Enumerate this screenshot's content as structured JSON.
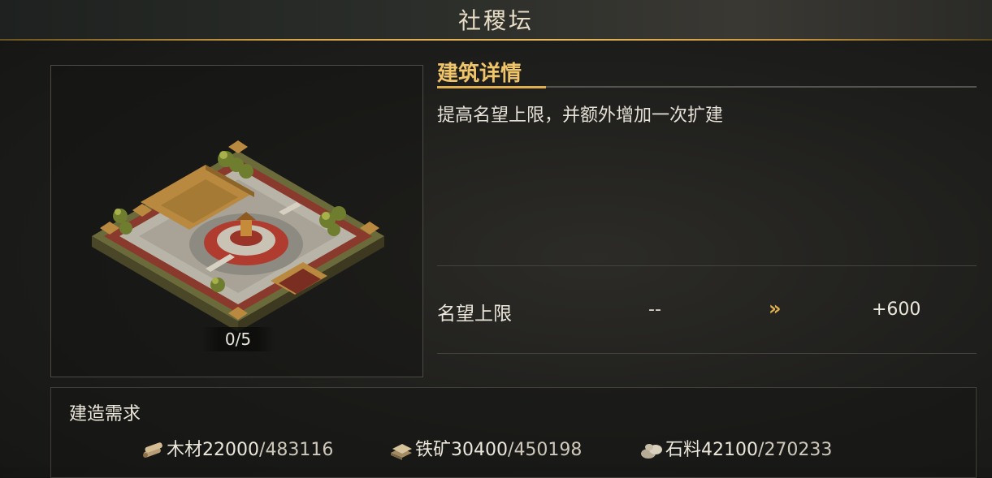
{
  "title": "社稷坛",
  "building_image": {
    "progress": "0/5"
  },
  "details": {
    "heading": "建筑详情",
    "description": "提高名望上限，并额外增加一次扩建"
  },
  "stat": {
    "name": "名望上限",
    "current": "--",
    "arrow": "»",
    "next": "+600"
  },
  "requirements": {
    "title": "建造需求",
    "resources": [
      {
        "icon": "wood-icon",
        "name": "木材",
        "required": "22000",
        "owned": "483116"
      },
      {
        "icon": "iron-ore-icon",
        "name": "铁矿",
        "required": "30400",
        "owned": "450198"
      },
      {
        "icon": "stone-icon",
        "name": "石料",
        "required": "42100",
        "owned": "270233"
      }
    ]
  },
  "colors": {
    "accent_gold": "#e0b04f",
    "text_light": "#ece7db"
  }
}
